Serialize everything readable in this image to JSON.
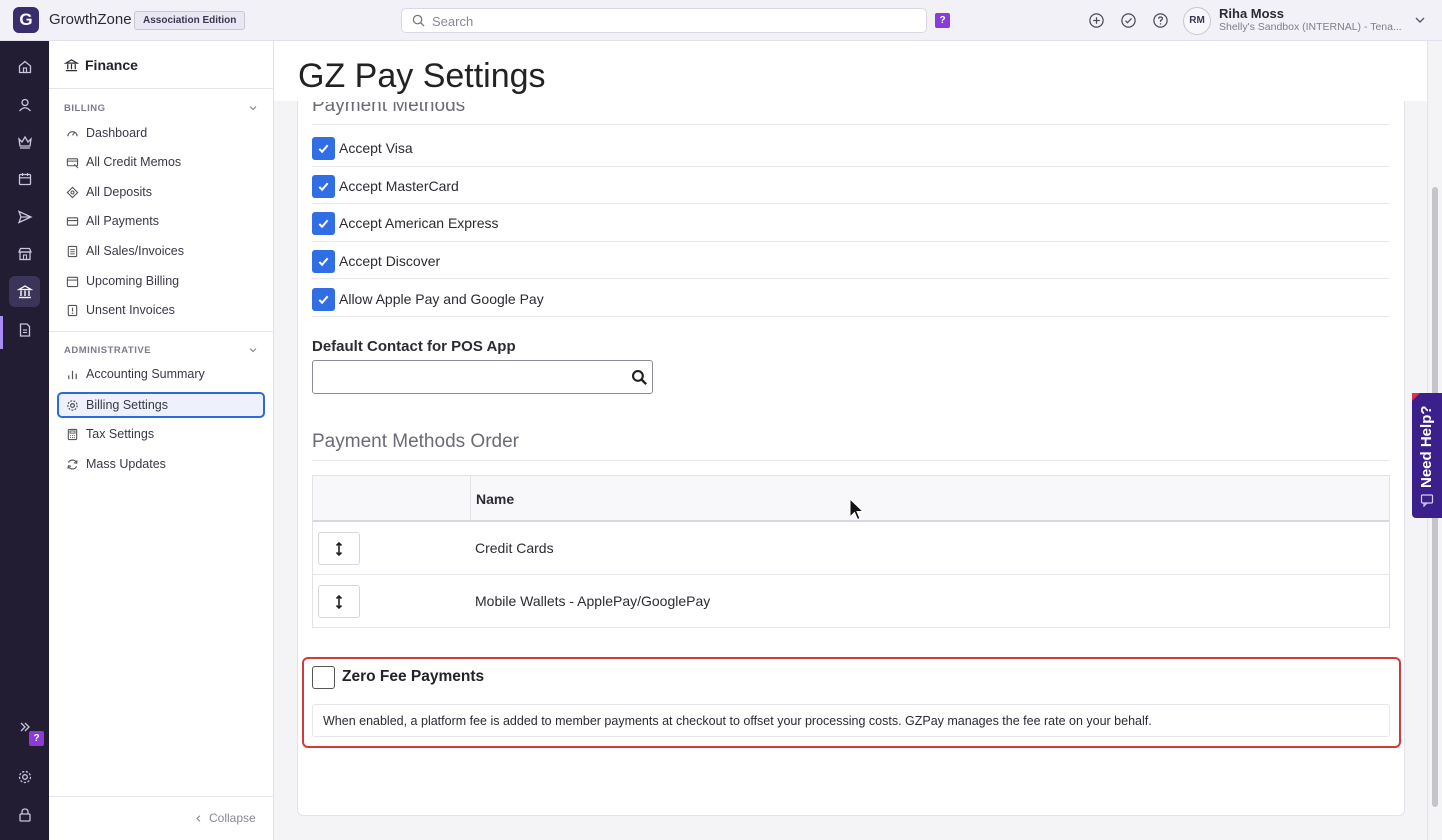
{
  "topbar": {
    "logo_letter": "G",
    "brand": "GrowthZone",
    "edition": "Association Edition",
    "search_placeholder": "Search",
    "help_badge": "?",
    "user_initials": "RM",
    "user_name": "Riha Moss",
    "user_org": "Shelly's Sandbox (INTERNAL) - Tena..."
  },
  "rail": {
    "help_badge": "?",
    "items": [
      "home-icon",
      "contacts-icon",
      "crown-icon",
      "calendar-icon",
      "send-icon",
      "store-icon",
      "finance-icon",
      "reports-icon"
    ]
  },
  "sidebar": {
    "title": "Finance",
    "billing_section": "BILLING",
    "billing_items": [
      {
        "label": "Dashboard",
        "icon": "gauge-icon"
      },
      {
        "label": "All Credit Memos",
        "icon": "credit-memo-icon"
      },
      {
        "label": "All Deposits",
        "icon": "deposit-icon"
      },
      {
        "label": "All Payments",
        "icon": "card-icon"
      },
      {
        "label": "All Sales/Invoices",
        "icon": "invoice-icon"
      },
      {
        "label": "Upcoming Billing",
        "icon": "calendar-icon"
      },
      {
        "label": "Unsent Invoices",
        "icon": "unsent-icon"
      }
    ],
    "admin_section": "ADMINISTRATIVE",
    "admin_items": [
      {
        "label": "Accounting Summary",
        "icon": "bar-chart-icon"
      },
      {
        "label": "Billing Settings",
        "icon": "gear-icon"
      },
      {
        "label": "Tax Settings",
        "icon": "calculator-icon"
      },
      {
        "label": "Mass Updates",
        "icon": "refresh-icon"
      }
    ],
    "collapse_label": "Collapse"
  },
  "main": {
    "page_title": "GZ Pay Settings",
    "payment_methods_heading": "Payment Methods",
    "payment_methods": [
      {
        "label": "Accept Visa",
        "checked": true
      },
      {
        "label": "Accept MasterCard",
        "checked": true
      },
      {
        "label": "Accept American Express",
        "checked": true
      },
      {
        "label": "Accept Discover",
        "checked": true
      },
      {
        "label": "Allow Apple Pay and Google Pay",
        "checked": true
      }
    ],
    "default_contact_label": "Default Contact for POS App",
    "default_contact_value": "",
    "order_heading": "Payment Methods Order",
    "order_table": {
      "column_name": "Name",
      "rows": [
        "Credit Cards",
        "Mobile Wallets - ApplePay/GooglePay"
      ]
    },
    "zero_fee": {
      "title": "Zero Fee Payments",
      "checked": false,
      "description": "When enabled, a platform fee is added to member payments at checkout to offset your processing costs. GZPay manages the fee rate on your behalf."
    }
  },
  "need_help_label": "Need Help?",
  "colors": {
    "accent": "#2f6ee5",
    "rail_bg": "#221d33",
    "highlight_border": "#d13a3a",
    "need_help_bg": "#3b1f8a",
    "badge": "#8b3bd8"
  }
}
